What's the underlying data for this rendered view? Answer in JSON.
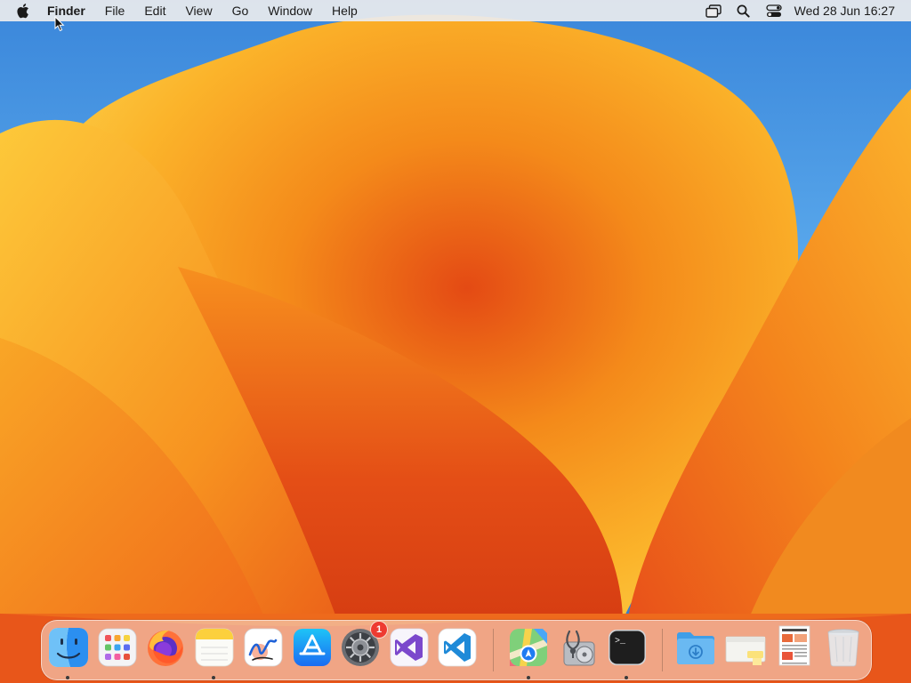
{
  "menubar": {
    "apple_icon": "apple-logo-icon",
    "app_name": "Finder",
    "menus": [
      "File",
      "Edit",
      "View",
      "Go",
      "Window",
      "Help"
    ],
    "status_icons": [
      "screen-mirroring-icon",
      "search-icon",
      "control-center-icon"
    ],
    "clock": "Wed 28 Jun  16:27"
  },
  "dock": {
    "apps": [
      {
        "id": "finder",
        "icon": "finder-icon",
        "running": true
      },
      {
        "id": "launchpad",
        "icon": "launchpad-icon",
        "running": false
      },
      {
        "id": "firefox",
        "icon": "firefox-icon",
        "running": false
      },
      {
        "id": "notes",
        "icon": "notes-icon",
        "running": true
      },
      {
        "id": "freeform",
        "icon": "freeform-icon",
        "running": false
      },
      {
        "id": "app-store",
        "icon": "app-store-icon",
        "running": false
      },
      {
        "id": "system-settings",
        "icon": "system-settings-icon",
        "running": false,
        "badge": "1"
      },
      {
        "id": "visual-studio",
        "icon": "visual-studio-icon",
        "running": false
      },
      {
        "id": "vscode",
        "icon": "vscode-icon",
        "running": false
      },
      {
        "id": "maps",
        "icon": "maps-icon",
        "running": true
      },
      {
        "id": "disk-utility",
        "icon": "disk-utility-icon",
        "running": false
      },
      {
        "id": "terminal",
        "icon": "terminal-icon",
        "running": true
      }
    ],
    "stacks": [
      {
        "id": "downloads",
        "icon": "downloads-folder-icon"
      },
      {
        "id": "document-stack",
        "icon": "document-stack-icon"
      },
      {
        "id": "document-preview",
        "icon": "document-preview-icon"
      },
      {
        "id": "trash",
        "icon": "trash-icon"
      }
    ],
    "terminal_prompt": ">_"
  },
  "colors": {
    "wallpaper_blue": "#3a86da",
    "wallpaper_orange": "#f39a1c",
    "wallpaper_deep": "#e0461c",
    "badge_red": "#ee3b31"
  }
}
